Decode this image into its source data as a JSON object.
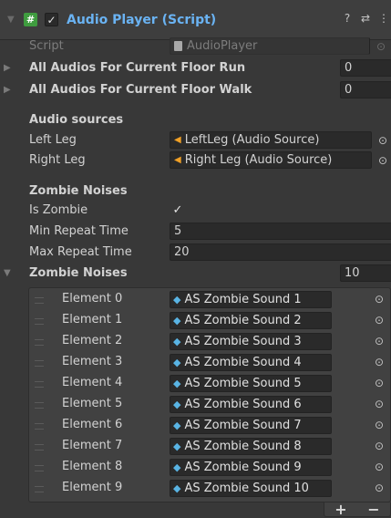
{
  "header": {
    "title": "Audio Player (Script)",
    "enabled_check": "✓",
    "script_icon": "#",
    "help_icon": "?",
    "preset_icon": "⇄",
    "menu_icon": "⋮"
  },
  "fields": {
    "script_label": "Script",
    "script_value": "AudioPlayer",
    "floor_run_label": "All Audios For Current Floor Run",
    "floor_run_value": "0",
    "floor_walk_label": "All Audios For Current Floor Walk",
    "floor_walk_value": "0",
    "audio_sources_header": "Audio sources",
    "left_leg_label": "Left Leg",
    "left_leg_value": "LeftLeg (Audio Source)",
    "right_leg_label": "Right Leg",
    "right_leg_value": "Right Leg (Audio Source)",
    "zombie_noises_header": "Zombie Noises",
    "is_zombie_label": "Is Zombie",
    "is_zombie_value": "✓",
    "min_repeat_label": "Min Repeat Time",
    "min_repeat_value": "5",
    "max_repeat_label": "Max Repeat Time",
    "max_repeat_value": "20",
    "zombie_noises_list_label": "Zombie Noises",
    "zombie_noises_size": "10"
  },
  "elements": [
    {
      "label": "Element 0",
      "value": "AS Zombie Sound 1"
    },
    {
      "label": "Element 1",
      "value": "AS Zombie Sound 2"
    },
    {
      "label": "Element 2",
      "value": "AS Zombie Sound 3"
    },
    {
      "label": "Element 3",
      "value": "AS Zombie Sound 4"
    },
    {
      "label": "Element 4",
      "value": "AS Zombie Sound 5"
    },
    {
      "label": "Element 5",
      "value": "AS Zombie Sound 6"
    },
    {
      "label": "Element 6",
      "value": "AS Zombie Sound 7"
    },
    {
      "label": "Element 7",
      "value": "AS Zombie Sound 8"
    },
    {
      "label": "Element 8",
      "value": "AS Zombie Sound 9"
    },
    {
      "label": "Element 9",
      "value": "AS Zombie Sound 10"
    }
  ],
  "list_buttons": {
    "add": "+",
    "remove": "−"
  },
  "colors": {
    "accent": "#6ab3f3",
    "background": "#383838",
    "field": "#2a2a2a"
  }
}
